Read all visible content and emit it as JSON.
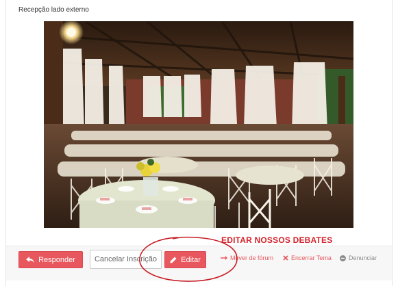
{
  "post": {
    "caption": "Recepção lado externo"
  },
  "actions": {
    "reply_label": "Responder",
    "cancel_subscription_label": "Cancelar Inscrição",
    "edit_label": "Editar",
    "move_forum_label": "Mover de fórum",
    "close_topic_label": "Encerrar Tema",
    "report_label": "Denunciar"
  },
  "annotation": {
    "text": "EDITAR NOSSOS DEBATES",
    "color": "#d4222a"
  },
  "colors": {
    "accent": "#e8575d"
  },
  "icons": {
    "reply": "reply-arrow-icon",
    "edit": "pencil-icon",
    "move": "arrow-right-icon",
    "close": "x-icon",
    "report": "minus-circle-icon"
  }
}
